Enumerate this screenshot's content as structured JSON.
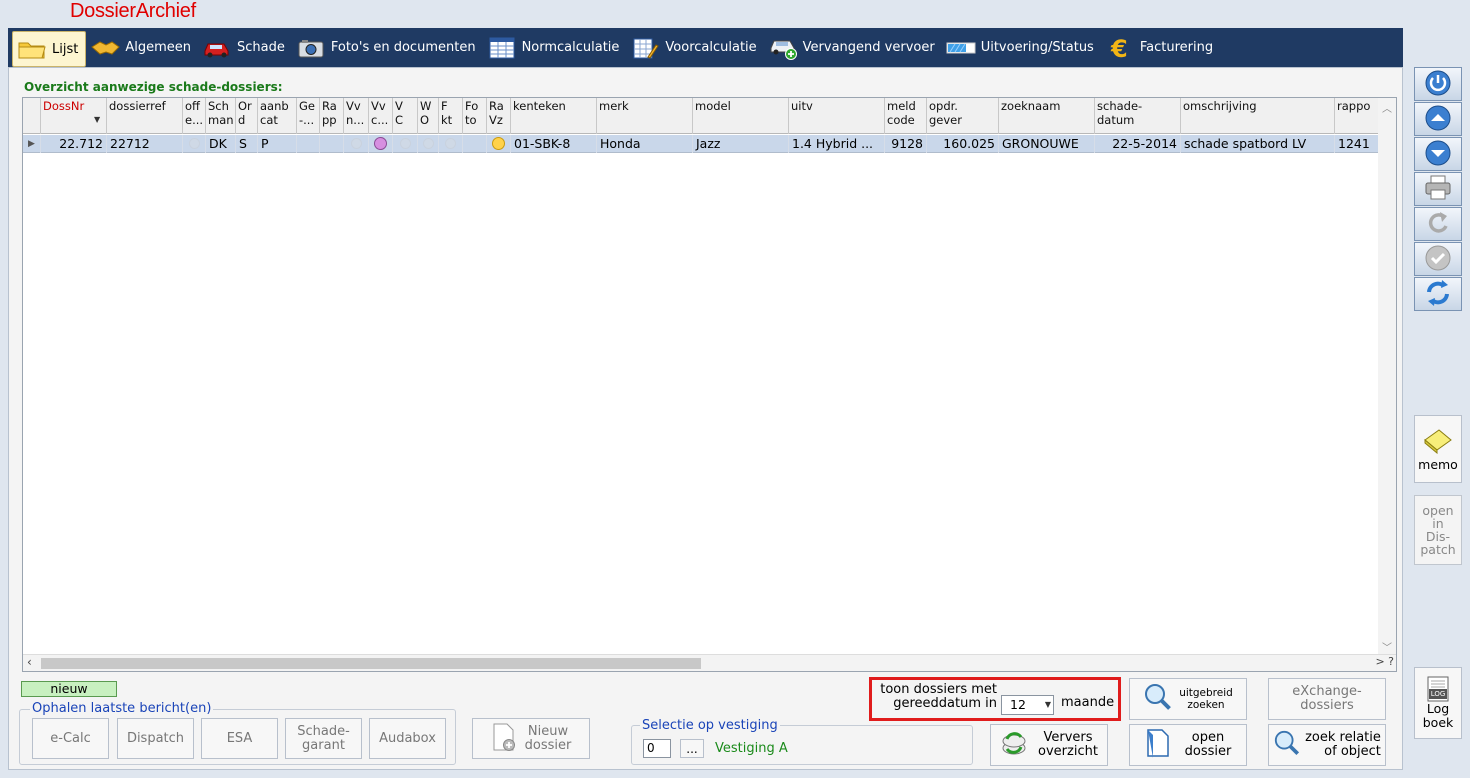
{
  "app_title": "DossierArchief",
  "tabs": [
    {
      "label": "Lijst",
      "icon": "folder-icon",
      "active": true
    },
    {
      "label": "Algemeen",
      "icon": "handshake-icon"
    },
    {
      "label": "Schade",
      "icon": "car-damage-icon"
    },
    {
      "label": "Foto's en documenten",
      "icon": "camera-icon"
    },
    {
      "label": "Normcalculatie",
      "icon": "spreadsheet-icon"
    },
    {
      "label": "Voorcalculatie",
      "icon": "calculator-pencil-icon"
    },
    {
      "label": "Vervangend vervoer",
      "icon": "car-add-icon"
    },
    {
      "label": "Uitvoering/Status",
      "icon": "progress-bar-icon"
    },
    {
      "label": "Facturering",
      "icon": "euro-icon"
    }
  ],
  "overview_label": "Overzicht aanwezige schade-dossiers:",
  "grid": {
    "columns": [
      "DossNr",
      "dossierref",
      "off\ne...",
      "Sch\nman",
      "Or\nd",
      "aanb\ncat",
      "Ge\n-...",
      "Ra\npp",
      "Vv\nn...",
      "Vv\nc...",
      "V\nC",
      "W\nO",
      "F\nkt",
      "Fo\nto",
      "Ra\nVz",
      "kenteken",
      "merk",
      "model",
      "uitv",
      "meld\ncode",
      "opdr.\ngever",
      "zoeknaam",
      "schade-\ndatum",
      "omschrijving",
      "rappo"
    ],
    "sort_column": "DossNr",
    "rows": [
      {
        "dossnr": "22.712",
        "dossierref": "22712",
        "schman": "DK",
        "ord": "S",
        "aanbcat": "P",
        "kenteken": "01-SBK-8",
        "merk": "Honda",
        "model": "Jazz",
        "uitv": "1.4 Hybrid ...",
        "meldcode": "9128",
        "opdrgever": "160.025",
        "zoeknaam": "GRONOUWE",
        "schadedatum": "22-5-2014",
        "omschrijving": "schade spatbord LV",
        "rappo": "1241",
        "vvc_color": "#d68fe0",
        "ravz_color": "#ffd24a"
      }
    ],
    "scroll_right_label": "> ?"
  },
  "bottom": {
    "nieuw_label": "nieuw",
    "ophalen_group_label": "Ophalen laatste bericht(en)",
    "ophalen_buttons": [
      "e-Calc",
      "Dispatch",
      "ESA",
      "Schade-\ngarant",
      "Audabox"
    ],
    "nieuw_dossier_label": "Nieuw\ndossier",
    "selectie_group_label": "Selectie op vestiging",
    "vestiging_value": "0",
    "vestiging_button": "...",
    "vestiging_name": "Vestiging A",
    "toon_label_line1": "toon dossiers met",
    "toon_label_line2": "gereeddatum in",
    "maanden_value": "12",
    "maanden_unit": "maande",
    "uitgebreid_zoeken": "uitgebreid\nzoeken",
    "exchange_dossiers": "eXchange-\ndossiers",
    "ververs_overzicht": "Ververs\noverzicht",
    "open_dossier": "open\ndossier",
    "zoek_relatie": "zoek relatie\nof object"
  },
  "sidebar": {
    "memo_label": "memo",
    "open_dispatch_label": "open\nin\nDis-\npatch",
    "logboek_label": "Log\nboek",
    "log_badge": "LOG"
  }
}
